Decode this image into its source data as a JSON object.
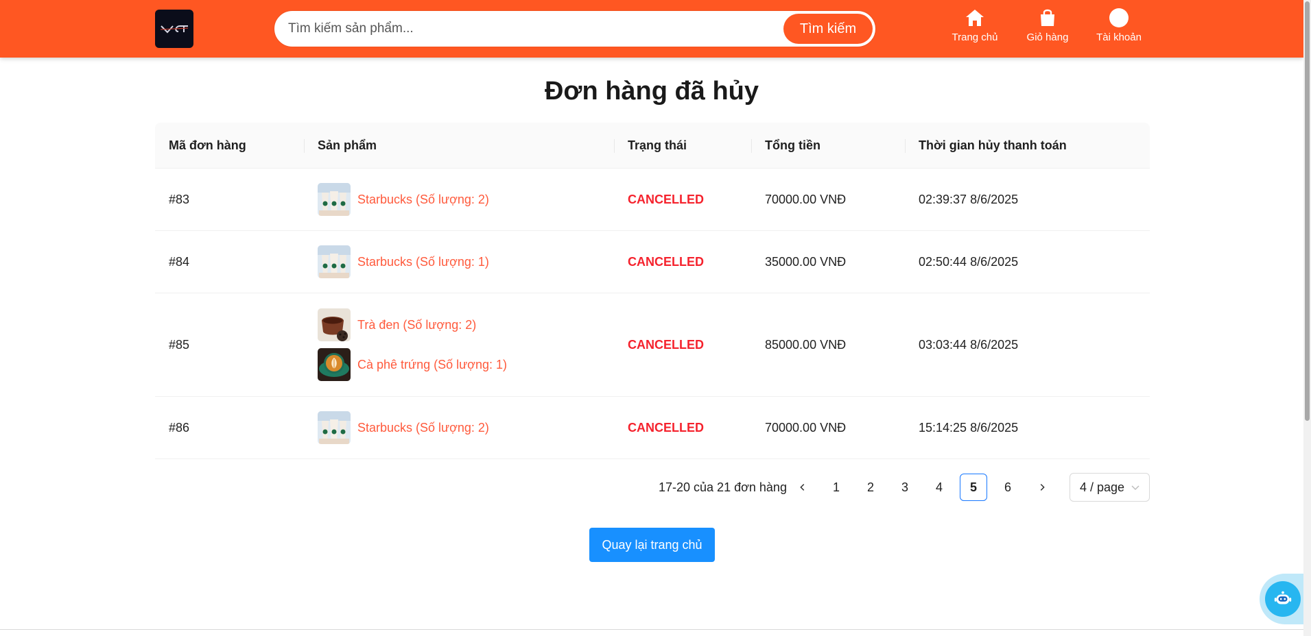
{
  "header": {
    "logo_text": "VCT",
    "search_placeholder": "Tìm kiếm sản phẩm...",
    "search_button": "Tìm kiếm",
    "nav": [
      {
        "label": "Trang chủ",
        "icon": "home-icon"
      },
      {
        "label": "Giỏ hàng",
        "icon": "shopping-bag-icon"
      },
      {
        "label": "Tài khoản",
        "icon": "user-icon"
      }
    ],
    "accent_color": "#ff5722"
  },
  "page_title": "Đơn hàng đã hủy",
  "table": {
    "columns": [
      "Mã đơn hàng",
      "Sản phẩm",
      "Trạng thái",
      "Tổng tiền",
      "Thời gian hủy thanh toán"
    ],
    "rows": [
      {
        "id": "#83",
        "products": [
          {
            "name": "Starbucks (Số lượng: 2)",
            "image": "starbucks-image"
          }
        ],
        "status": "CANCELLED",
        "total": "70000.00 VNĐ",
        "time": "02:39:37 8/6/2025"
      },
      {
        "id": "#84",
        "products": [
          {
            "name": "Starbucks (Số lượng: 1)",
            "image": "starbucks-image"
          }
        ],
        "status": "CANCELLED",
        "total": "35000.00 VNĐ",
        "time": "02:50:44 8/6/2025"
      },
      {
        "id": "#85",
        "products": [
          {
            "name": "Trà đen (Số lượng: 2)",
            "image": "black-tea-image"
          },
          {
            "name": "Cà phê trứng (Số lượng: 1)",
            "image": "egg-coffee-image"
          }
        ],
        "status": "CANCELLED",
        "total": "85000.00 VNĐ",
        "time": "03:03:44 8/6/2025"
      },
      {
        "id": "#86",
        "products": [
          {
            "name": "Starbucks (Số lượng: 2)",
            "image": "starbucks-image"
          }
        ],
        "status": "CANCELLED",
        "total": "70000.00 VNĐ",
        "time": "15:14:25 8/6/2025"
      }
    ],
    "status_color": "#f5222d",
    "product_link_color": "#ff5a3c"
  },
  "pagination": {
    "total_text": "17-20 của 21 đơn hàng",
    "pages": [
      "1",
      "2",
      "3",
      "4",
      "5",
      "6"
    ],
    "current": "5",
    "page_size": "4 / page"
  },
  "back_button": "Quay lại trang chủ",
  "chatbot_icon": "robot-chat-icon"
}
